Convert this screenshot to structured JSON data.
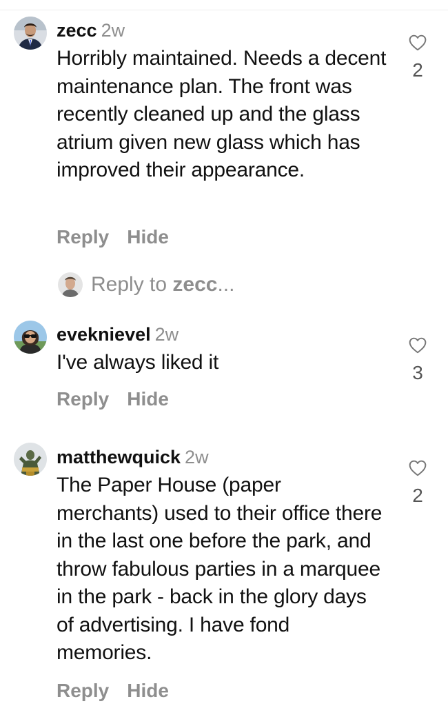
{
  "colors": {
    "primary_text": "#111111",
    "secondary_text": "#8e8e8e",
    "background": "#ffffff"
  },
  "comments": [
    {
      "username": "zecc",
      "time": "2w",
      "text": "Horribly maintained. Needs a decent maintenance plan. The front was recently cleaned up and the glass atrium given new glass which has improved their appearance.",
      "likes": "2",
      "reply_label": "Reply",
      "hide_label": "Hide",
      "avatar_icon": "man-in-suit-avatar"
    },
    {
      "username": "eveknievel",
      "time": "2w",
      "text": "I've always liked it",
      "likes": "3",
      "reply_label": "Reply",
      "hide_label": "Hide",
      "avatar_icon": "woman-with-sunglasses-avatar"
    },
    {
      "username": "matthewquick",
      "time": "2w",
      "text": "The Paper House (paper merchants) used to their office there in the last one before the park, and throw fabulous parties in a marquee in the park - back in the glory days of advertising. I have fond memories.",
      "likes": "2",
      "reply_label": "Reply",
      "hide_label": "Hide",
      "avatar_icon": "statue-avatar"
    }
  ],
  "reply_input": {
    "label": "Reply to",
    "username": "zecc",
    "ellipsis": "...",
    "avatar_icon": "current-user-avatar"
  },
  "icons": {
    "like": "heart-outline-icon"
  }
}
